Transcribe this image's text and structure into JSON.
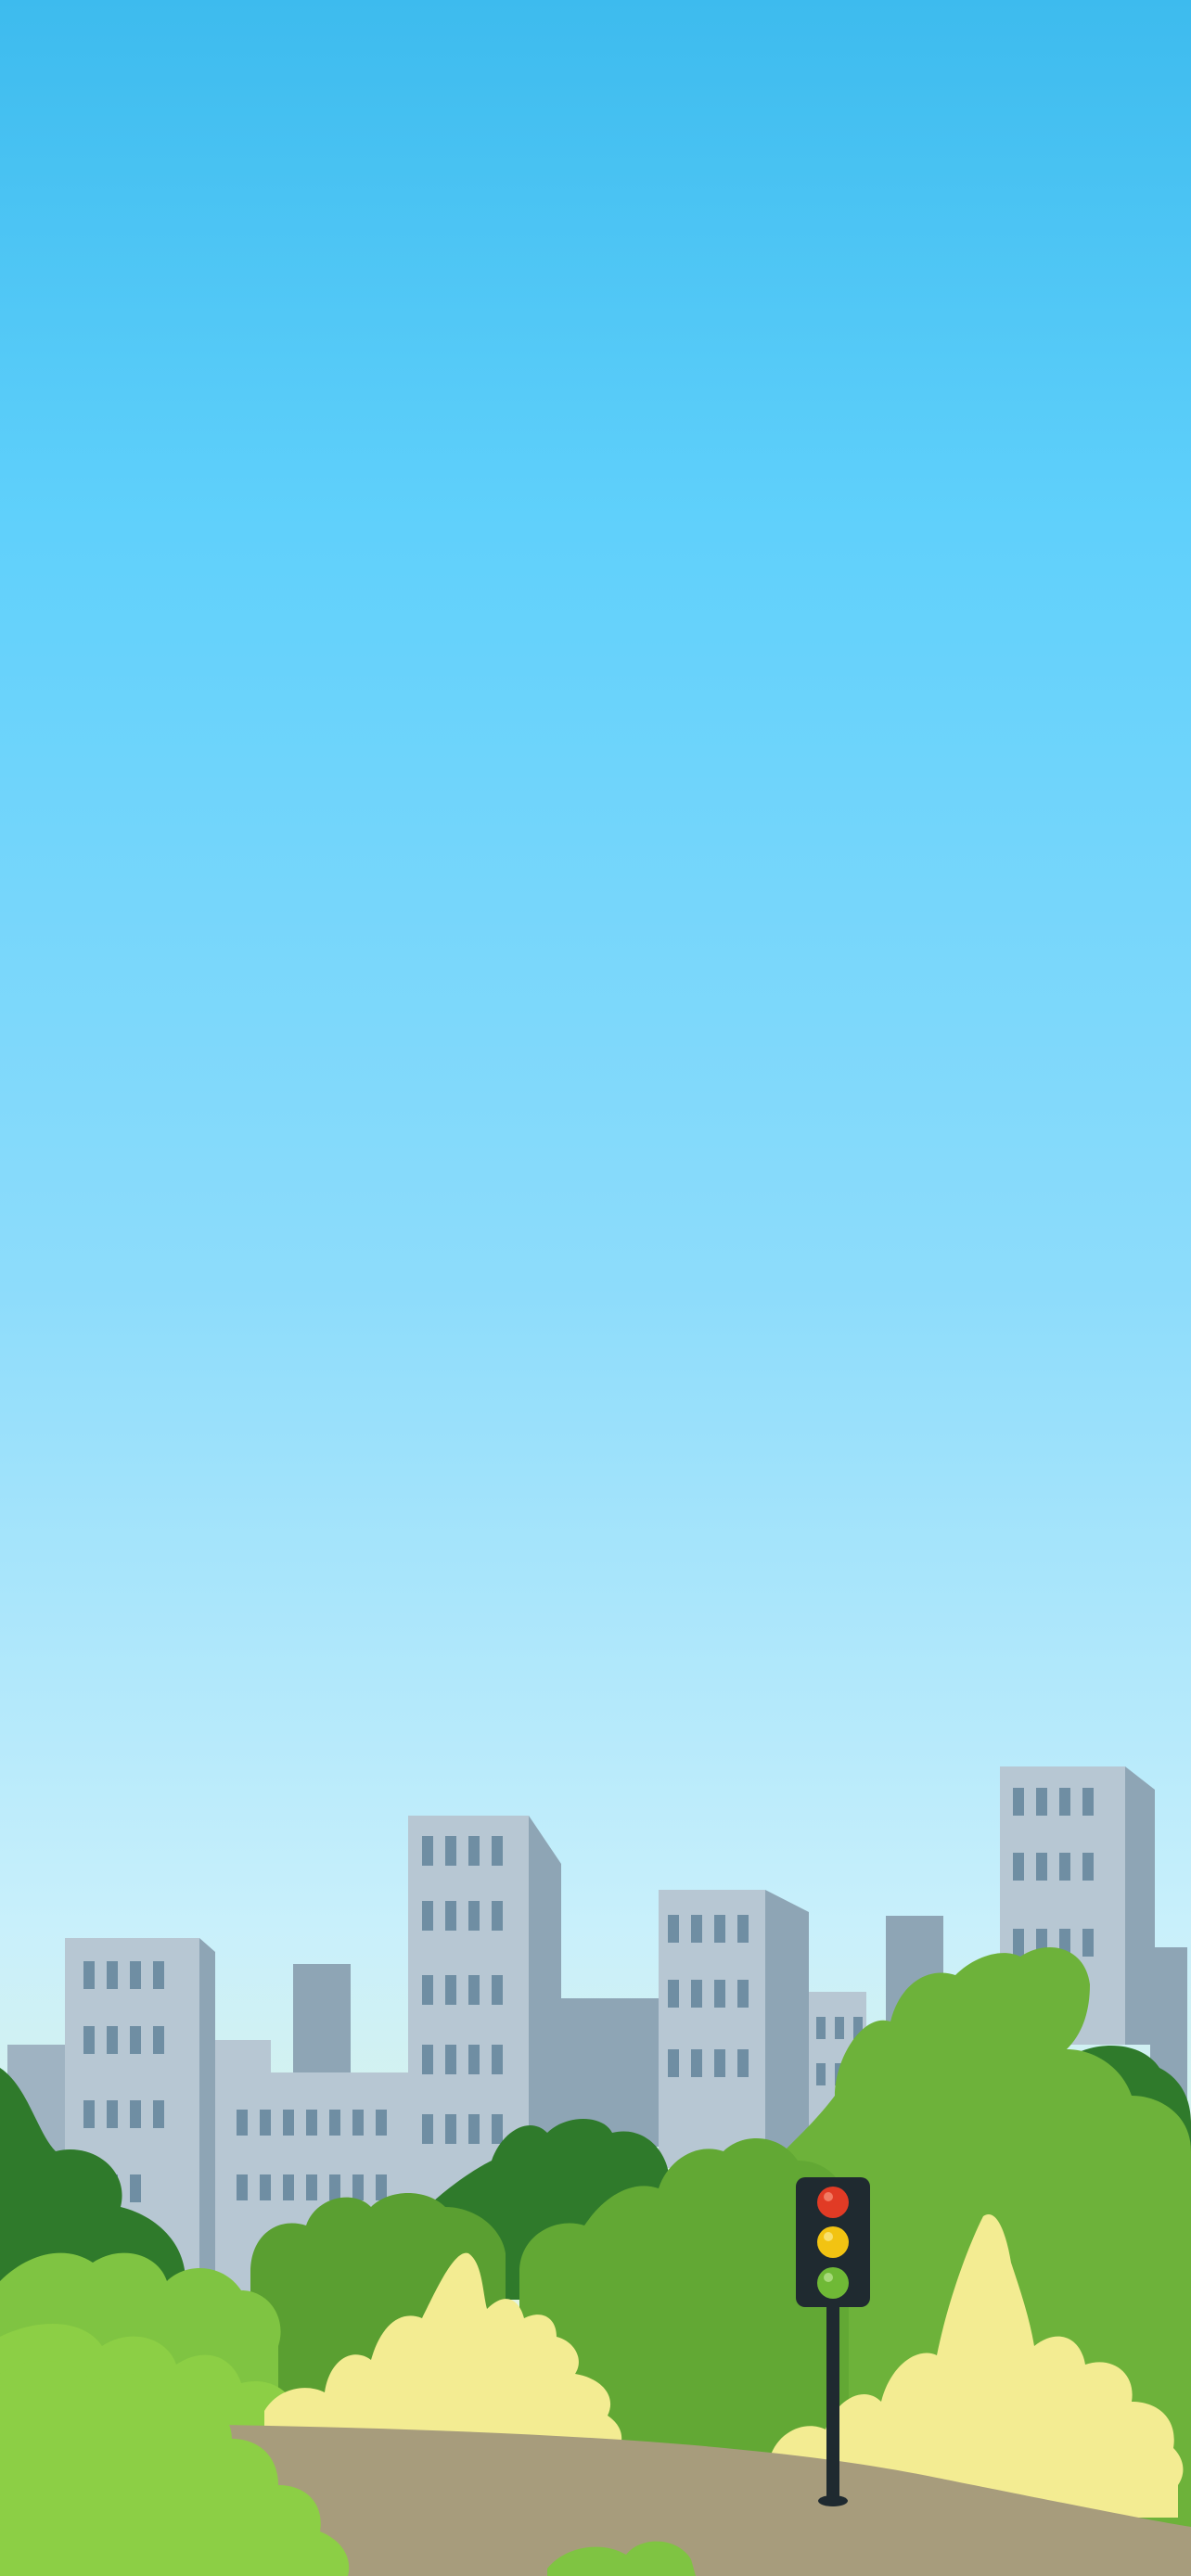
{
  "scene": {
    "description_type": "illustrated city wallpaper",
    "colors": {
      "sky_top": "#3dbbee",
      "sky_mid": "#8ddcfb",
      "sky_low": "#c9f0fb",
      "sky_horizon": "#dff3d6",
      "building_face": "#b7c7d3",
      "building_side": "#8ea5b5",
      "building_window": "#6f8ea3",
      "bush_dark": "#2f7a2b",
      "bush_mid": "#5ea832",
      "bush_light": "#8ccf45",
      "bush_pale": "#f3ec92",
      "path": "#a79c7c",
      "traffic_light_body": "#1f2a30",
      "light_red": "#e13b25",
      "light_yellow": "#f2c312",
      "light_green": "#6fb936"
    },
    "icons": [
      "traffic-light-icon"
    ]
  }
}
